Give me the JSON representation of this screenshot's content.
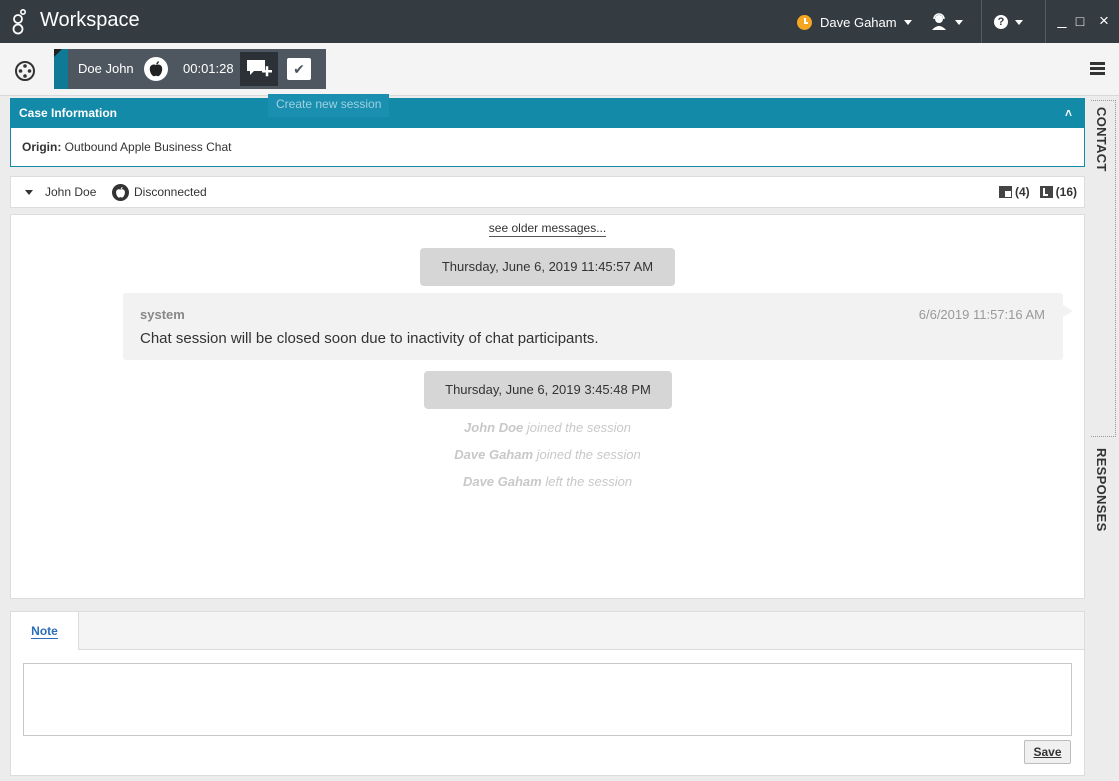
{
  "titlebar": {
    "app_title": "Workspace",
    "user_name": "Dave Gaham",
    "status_color": "#f5a623",
    "help_glyph": "?",
    "minimize": "_",
    "maximize": "□",
    "close": "×"
  },
  "interaction": {
    "contact_name": "Doe John",
    "timer": "00:01:28",
    "accent_color": "#0f7a96",
    "new_session_tooltip": "Create new session",
    "done_glyph": "✔"
  },
  "case_info": {
    "title": "Case Information",
    "collapse_glyph": "˄",
    "origin_label": "Origin:",
    "origin_value": "Outbound Apple Business Chat"
  },
  "party": {
    "name": "John Doe",
    "status": "Disconnected",
    "case_count": "(4)",
    "history_count": "(16)"
  },
  "transcript": {
    "older_link": "see older messages...",
    "date_1": "Thursday, June 6, 2019 11:45:57 AM",
    "message": {
      "sender": "system",
      "time": "6/6/2019 11:57:16 AM",
      "text": "Chat session will be closed soon due to inactivity of chat participants."
    },
    "date_2": "Thursday, June 6, 2019 3:45:48 PM",
    "events": [
      {
        "who": "John Doe",
        "action": " joined the session"
      },
      {
        "who": "Dave Gaham",
        "action": " joined the session"
      },
      {
        "who": "Dave Gaham",
        "action": " left the session"
      }
    ]
  },
  "note": {
    "tab_label": "Note",
    "value": "",
    "save_label": "Save"
  },
  "side_tabs": {
    "contact": "CONTACT",
    "responses": "RESPONSES"
  }
}
